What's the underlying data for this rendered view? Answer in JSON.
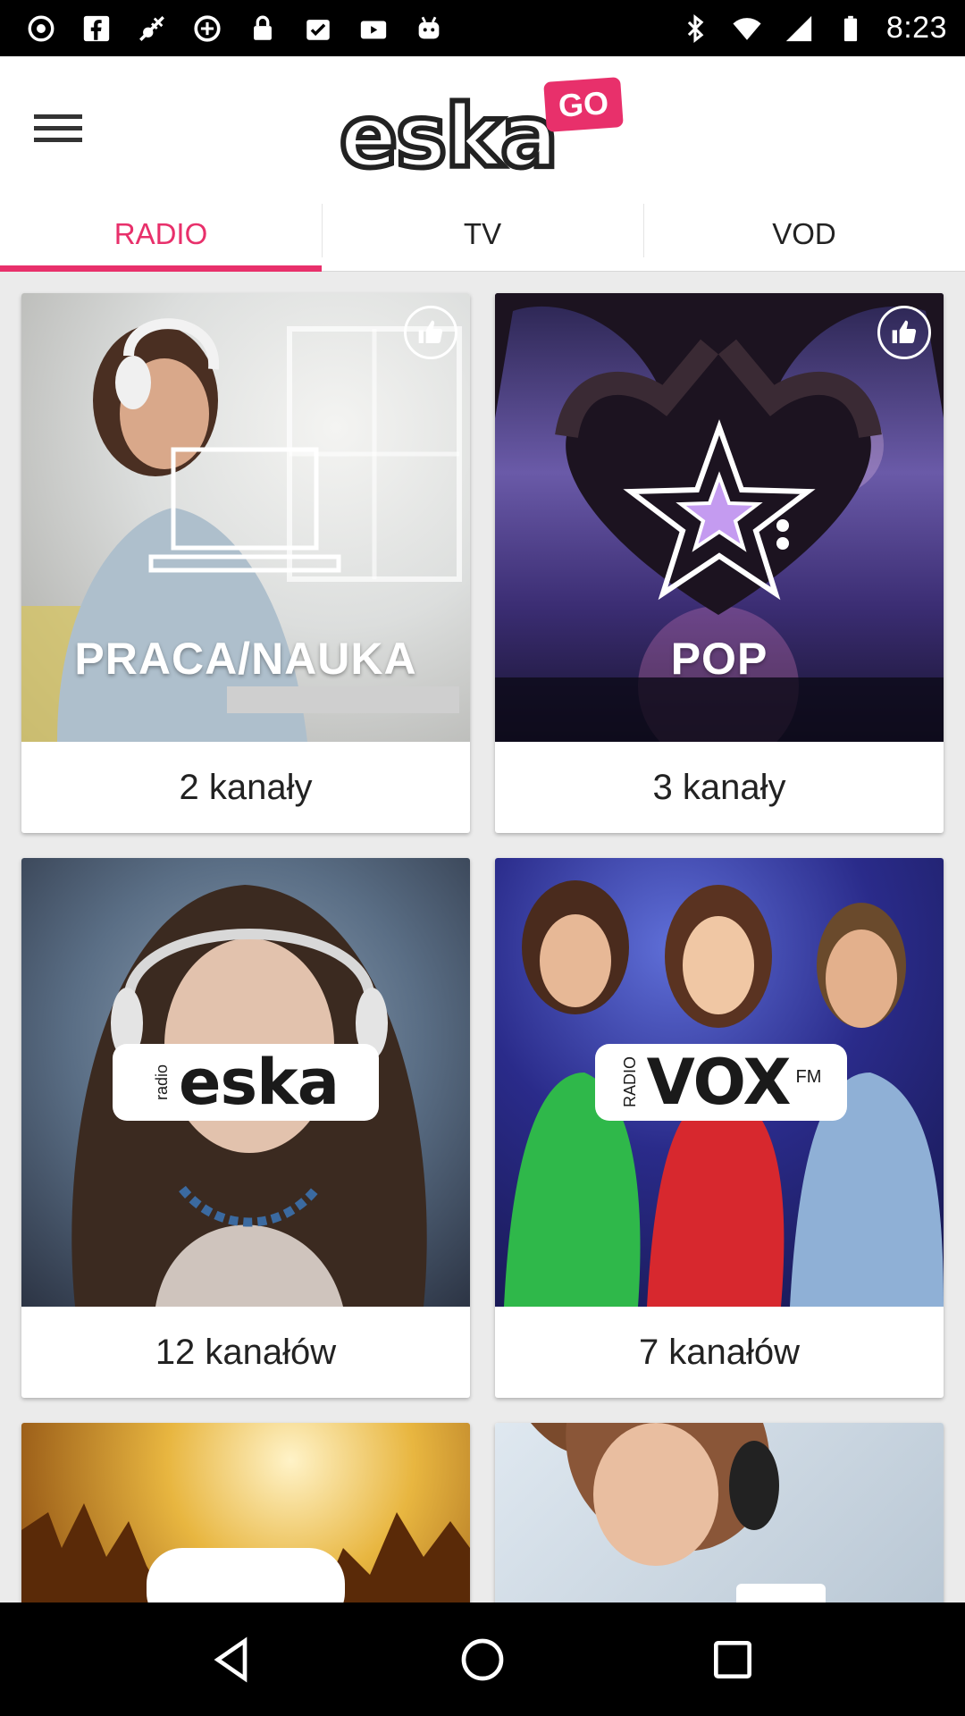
{
  "status_bar": {
    "time": "8:23",
    "left_icons": [
      "record-icon",
      "facebook-icon",
      "fake-gps-icon",
      "data-saver-icon",
      "lock-icon",
      "clipboard-check-icon",
      "video-play-icon",
      "android-icon"
    ],
    "right_icons": [
      "bluetooth-icon",
      "wifi-icon",
      "signal-icon",
      "battery-icon"
    ]
  },
  "header": {
    "menu_icon": "hamburger-menu-icon",
    "logo_text": "eska",
    "logo_badge": "GO"
  },
  "tabs": [
    {
      "label": "RADIO",
      "active": true
    },
    {
      "label": "TV",
      "active": false
    },
    {
      "label": "VOD",
      "active": false
    }
  ],
  "cards": [
    {
      "title": "PRACA/NAUKA",
      "caption": "2 kanały",
      "like": true
    },
    {
      "title": "POP",
      "caption": "3 kanały",
      "like": true
    },
    {
      "logo_small": "radio",
      "logo": "eska",
      "caption": "12 kanałów"
    },
    {
      "logo_small": "RADIO",
      "logo": "VOX",
      "logo_suffix": "FM",
      "caption": "7 kanałów"
    }
  ],
  "partial_logos": [
    "eska rock logo",
    "radio logo"
  ],
  "navigation": [
    "back-icon",
    "home-icon",
    "recents-icon"
  ],
  "colors": {
    "accent": "#e8306b",
    "status_bar": "#000000",
    "background": "#ebebeb"
  }
}
